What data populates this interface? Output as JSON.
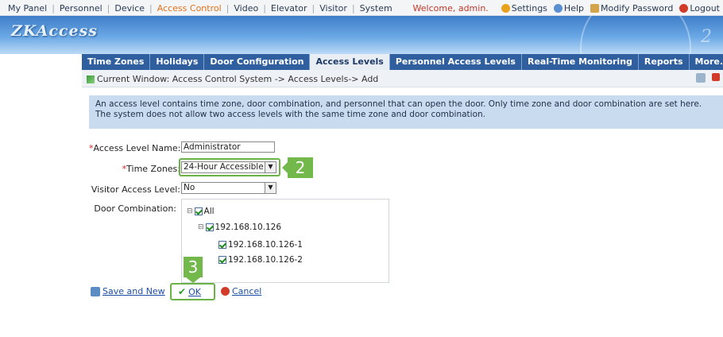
{
  "topnav": {
    "items": [
      "My Panel",
      "Personnel",
      "Device",
      "Access Control",
      "Video",
      "Elevator",
      "Visitor",
      "System"
    ],
    "active_index": 3
  },
  "topright": {
    "welcome": "Welcome, admin.",
    "settings": "Settings",
    "help": "Help",
    "modify_password": "Modify Password",
    "logout": "Logout"
  },
  "banner": {
    "logo": "ZKAccess"
  },
  "tabs": {
    "items": [
      "Time Zones",
      "Holidays",
      "Door Configuration",
      "Access Levels",
      "Personnel Access Levels",
      "Real-Time Monitoring",
      "Reports",
      "More..."
    ],
    "active_index": 3
  },
  "crumb": {
    "text": "Current Window: Access Control System -> Access Levels-> Add"
  },
  "info": {
    "text": "An access level contains time zone, door combination, and personnel that can open the door. Only time zone and door combination are set here. The system does not allow two access levels with the same time zone and door combination."
  },
  "form": {
    "name_label": "Access Level Name:",
    "name_value": "Administrator",
    "tz_label": "Time Zones:",
    "tz_value": "24-Hour Accessible",
    "visitor_label": "Visitor Access Level:",
    "visitor_value": "No",
    "door_label": "Door Combination:"
  },
  "tree": {
    "all": "All",
    "device": "192.168.10.126",
    "doors": [
      "192.168.10.126-1",
      "192.168.10.126-2"
    ]
  },
  "callouts": {
    "step2": "2",
    "step3": "3"
  },
  "buttons": {
    "save_new": "Save and New",
    "ok": "OK",
    "cancel": "Cancel"
  },
  "colors": {
    "accent_green": "#72b84a",
    "tab_bar": "#2f5f9e",
    "active_orange": "#e2711b"
  }
}
